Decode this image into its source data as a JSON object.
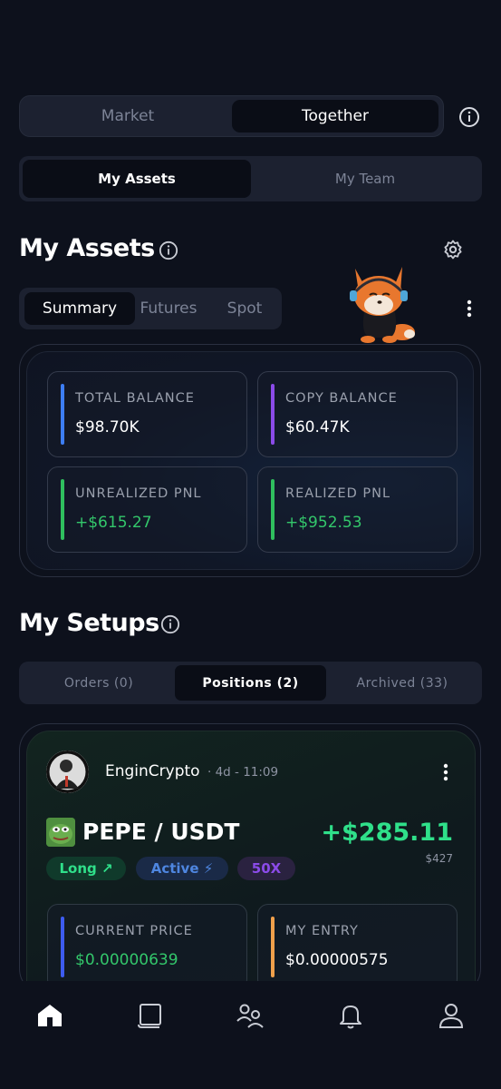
{
  "top_toggle": {
    "market": "Market",
    "together": "Together"
  },
  "sub_toggle": {
    "my_assets": "My Assets",
    "my_team": "My Team"
  },
  "assets": {
    "title": "My Assets",
    "tabs": [
      "Summary",
      "Futures",
      "Spot"
    ],
    "stats": [
      {
        "label": "TOTAL BALANCE",
        "value": "$98.70K",
        "color": "#3d7ef5"
      },
      {
        "label": "COPY BALANCE",
        "value": "$60.47K",
        "color": "#8b4be8"
      },
      {
        "label": "UNREALIZED PNL",
        "value": "+$615.27",
        "color": "#2fbf5e"
      },
      {
        "label": "REALIZED PNL",
        "value": "+$952.53",
        "color": "#2fbf5e"
      }
    ]
  },
  "setups": {
    "title": "My Setups",
    "tabs": [
      "Orders (0)",
      "Positions (2)",
      "Archived (33)"
    ],
    "card": {
      "user": "EnginCrypto",
      "time": "· 4d - 11:09",
      "pair": "PEPE / USDT",
      "pnl": "+$285.11",
      "pnl_sub": "$427",
      "tags": {
        "side": "Long ↗",
        "status": "Active ⚡",
        "leverage": "50X"
      },
      "current_price_label": "CURRENT PRICE",
      "current_price": "$0.00000639",
      "entry_label": "MY ENTRY",
      "entry": "$0.00000575"
    }
  },
  "nav": [
    "home-icon",
    "book-icon",
    "users-icon",
    "bell-icon",
    "profile-icon"
  ],
  "colors": {
    "accent_green": "#2fe08a",
    "background": "#0d111c"
  }
}
